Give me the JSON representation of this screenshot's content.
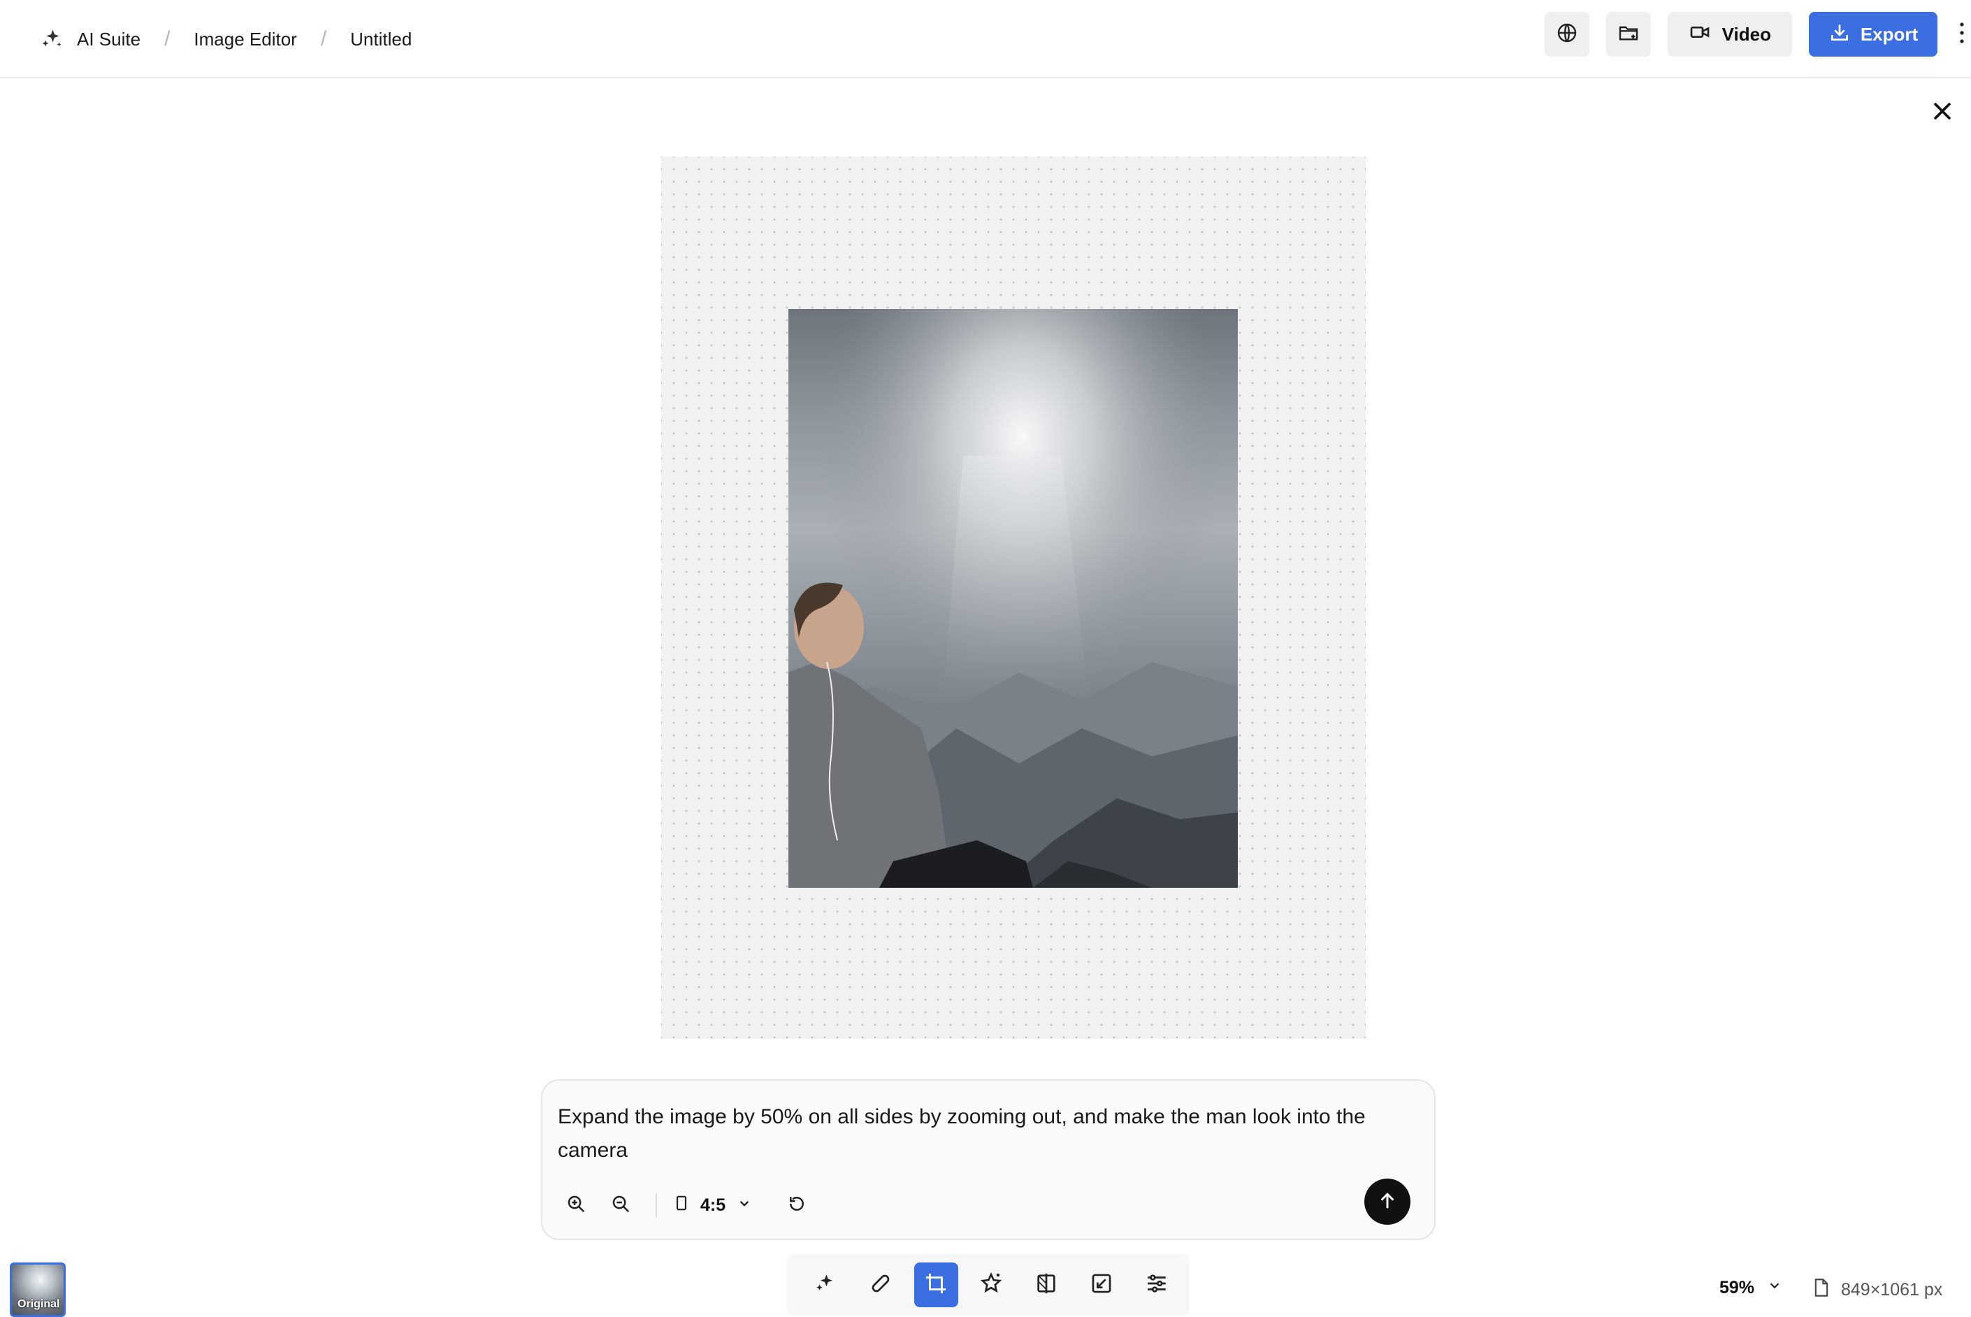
{
  "breadcrumb": {
    "items": [
      "AI Suite",
      "Image Editor",
      "Untitled"
    ],
    "separator": "/"
  },
  "header": {
    "globe_icon": "globe-icon",
    "folder_icon": "folder-add-icon",
    "video_label": "Video",
    "export_label": "Export"
  },
  "prompt": {
    "text": "Expand the image by 50% on all sides by zooming out, and make the man look into the camera",
    "aspect_ratio": "4:5"
  },
  "toolbar": {
    "tools": [
      "magic-edit",
      "heal",
      "crop-expand",
      "enhance",
      "compare",
      "resize",
      "adjust"
    ],
    "active_tool": "crop-expand"
  },
  "footer": {
    "thumbnail_label": "Original",
    "zoom": "59%",
    "dimensions": "849×1061 px"
  },
  "colors": {
    "accent": "#3b6ee0",
    "send_button": "#111111"
  }
}
